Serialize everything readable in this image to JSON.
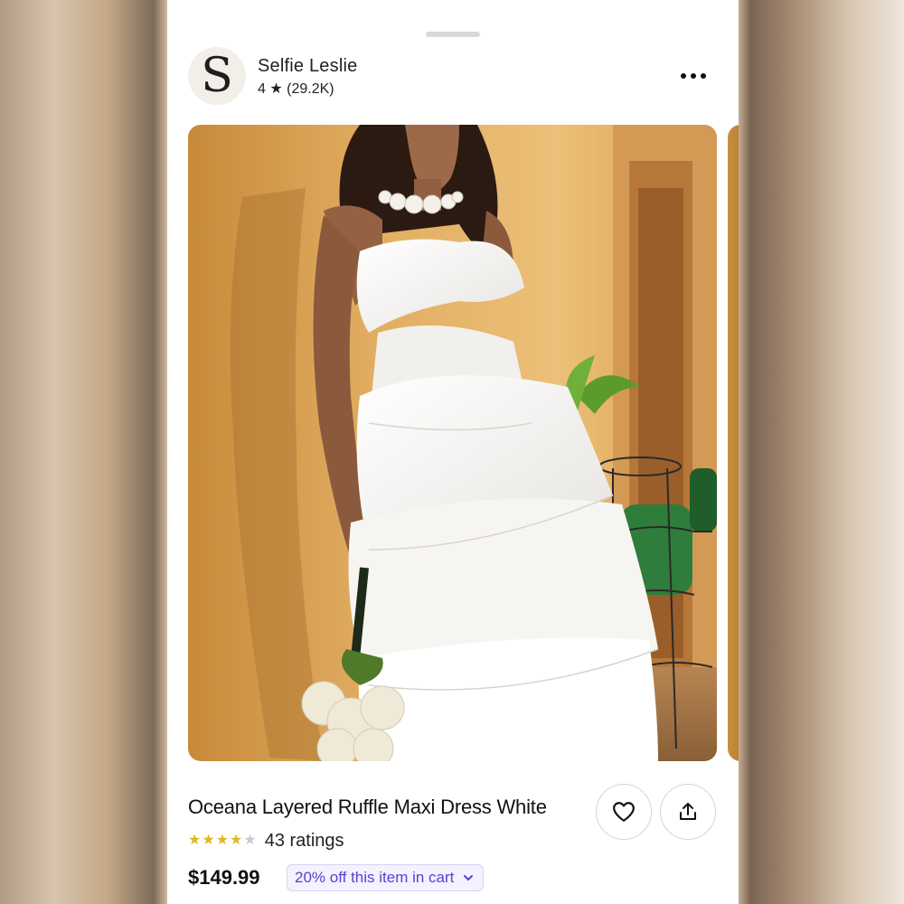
{
  "shop": {
    "avatar_letter": "S",
    "name": "Selfie Leslie",
    "rating_text": "4 ★ (29.2K)"
  },
  "header": {
    "more_icon": "more-horizontal-icon"
  },
  "product": {
    "title": "Oceana Layered Ruffle Maxi Dress White",
    "rating_value": 4,
    "rating_max": 5,
    "ratings_label": "43 ratings",
    "price": "$149.99",
    "promo": "20% off this item in cart",
    "image_alt": "Model wearing white layered ruffle maxi dress"
  },
  "actions": {
    "favorite_icon": "heart-icon",
    "share_icon": "share-icon"
  },
  "colors": {
    "promo_text": "#5b3fd1",
    "promo_bg": "#f5f2ff",
    "star": "#e0b62a"
  }
}
